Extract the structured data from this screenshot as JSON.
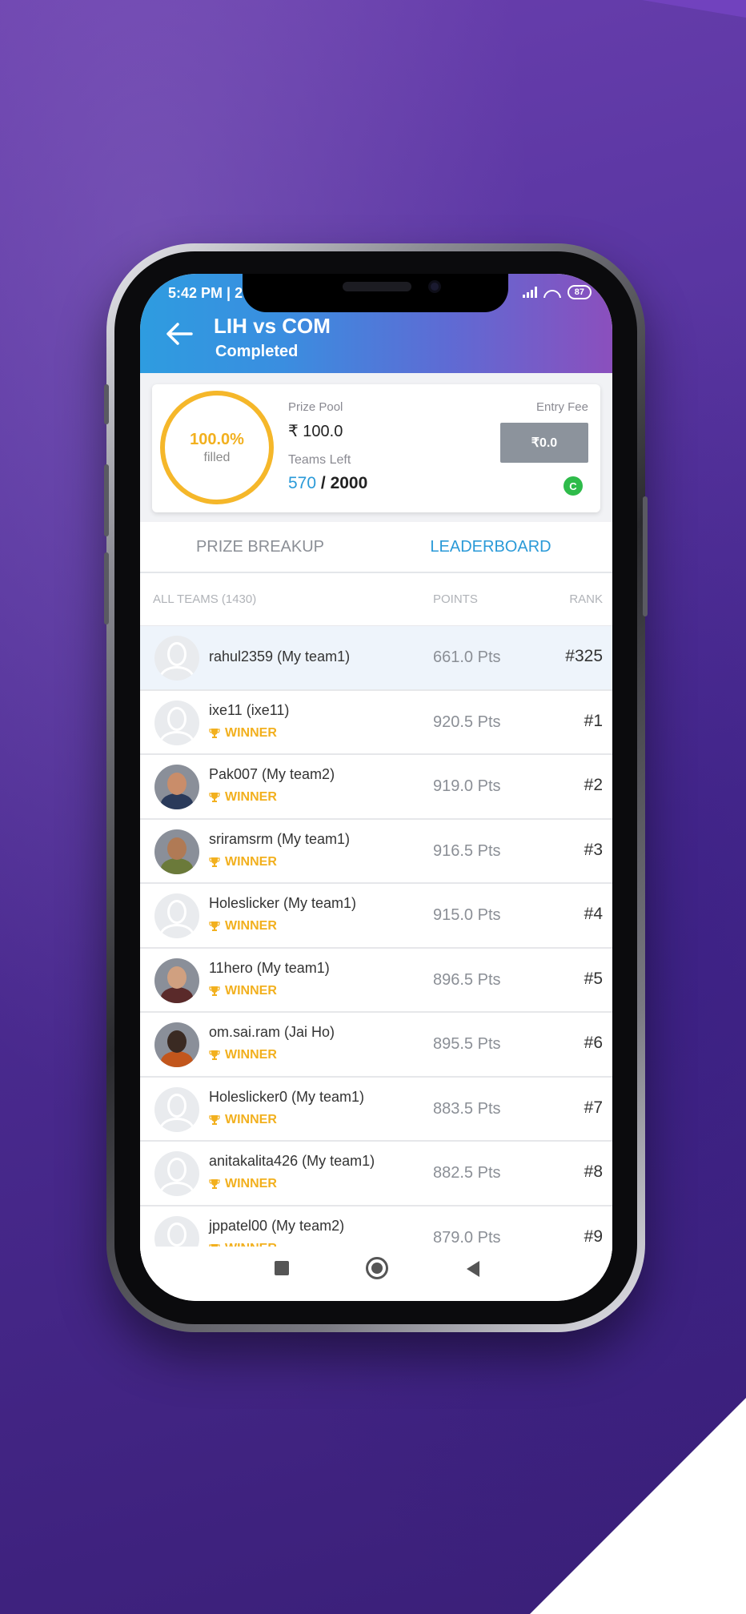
{
  "status": {
    "time": "5:42 PM | 2",
    "battery": "87"
  },
  "header": {
    "title": "LIH vs COM",
    "subtitle": "Completed"
  },
  "contest": {
    "fill_percent": "100.0%",
    "fill_label": "filled",
    "prize_pool_label": "Prize Pool",
    "prize_pool_value": "₹ 100.0",
    "teams_left_label": "Teams Left",
    "teams_left": "570",
    "teams_separator": " / ",
    "teams_total": "2000",
    "entry_fee_label": "Entry Fee",
    "entry_fee_value": "₹0.0",
    "badge": "C"
  },
  "tabs": {
    "prize_breakup": "PRIZE BREAKUP",
    "leaderboard": "LEADERBOARD"
  },
  "list_header": {
    "teams": "ALL TEAMS (1430)",
    "points": "POINTS",
    "rank": "RANK"
  },
  "winner_label": "WINNER",
  "rows": [
    {
      "name": "rahul2359 (My team1)",
      "points": "661.0 Pts",
      "rank": "#325",
      "winner": "",
      "mine": true,
      "avatar": "placeholder"
    },
    {
      "name": "ixe11 (ixe11)",
      "points": "920.5 Pts",
      "rank": "#1",
      "winner": "WINNER",
      "avatar": "placeholder"
    },
    {
      "name": "Pak007 (My team2)",
      "points": "919.0 Pts",
      "rank": "#2",
      "winner": "WINNER",
      "avatar": "photo"
    },
    {
      "name": "sriramsrm (My team1)",
      "points": "916.5 Pts",
      "rank": "#3",
      "winner": "WINNER",
      "avatar": "photo"
    },
    {
      "name": "Holeslicker (My team1)",
      "points": "915.0 Pts",
      "rank": "#4",
      "winner": "WINNER",
      "avatar": "placeholder"
    },
    {
      "name": "11hero (My team1)",
      "points": "896.5 Pts",
      "rank": "#5",
      "winner": "WINNER",
      "avatar": "photo"
    },
    {
      "name": "om.sai.ram (Jai Ho)",
      "points": "895.5 Pts",
      "rank": "#6",
      "winner": "WINNER",
      "avatar": "photo"
    },
    {
      "name": "Holeslicker0 (My team1)",
      "points": "883.5 Pts",
      "rank": "#7",
      "winner": "WINNER",
      "avatar": "placeholder"
    },
    {
      "name": "anitakalita426 (My team1)",
      "points": "882.5 Pts",
      "rank": "#8",
      "winner": "WINNER",
      "avatar": "placeholder"
    },
    {
      "name": "jppatel00 (My team2)",
      "points": "879.0 Pts",
      "rank": "#9",
      "winner": "WINNER",
      "avatar": "placeholder"
    }
  ],
  "colors": {
    "accent_blue": "#2a9ad8",
    "winner_gold": "#f2b01e",
    "ring": "#f5b72a",
    "badge_green": "#2ebb4a"
  },
  "icons": {
    "back": "back-arrow-icon",
    "trophy": "trophy-icon",
    "nav": [
      "nav-recents-icon",
      "nav-home-icon",
      "nav-back-icon"
    ]
  }
}
